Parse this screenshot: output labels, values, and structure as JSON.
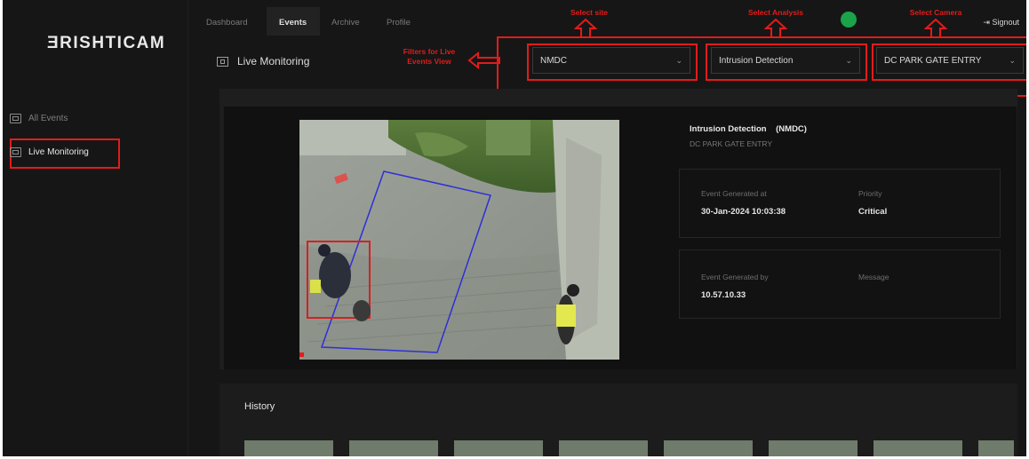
{
  "app": {
    "logo": "ƎRISHTICAM"
  },
  "nav": {
    "tabs": [
      {
        "label": "Dashboard",
        "active": false
      },
      {
        "label": "Events",
        "active": true
      },
      {
        "label": "Archive",
        "active": false
      },
      {
        "label": "Profile",
        "active": false
      }
    ],
    "signout": "Signout",
    "status_color": "#1aa34a"
  },
  "sidebar": {
    "items": [
      {
        "label": "All Events",
        "icon": "image-icon"
      },
      {
        "label": "Live Monitoring",
        "icon": "monitor-icon",
        "active": true
      }
    ]
  },
  "page": {
    "title": "Live Monitoring"
  },
  "annotations": {
    "filters": "Filters for Live\nEvents View",
    "site": "Select site",
    "analysis": "Select Analysis",
    "camera": "Select Camera"
  },
  "filters": {
    "site": "NMDC",
    "analysis": "Intrusion Detection",
    "camera": "DC PARK GATE ENTRY"
  },
  "event": {
    "title": "Intrusion Detection",
    "site_tag": "(NMDC)",
    "camera": "DC PARK GATE ENTRY",
    "generated_at_label": "Event Generated at",
    "generated_at": "30-Jan-2024 10:03:38",
    "priority_label": "Priority",
    "priority": "Critical",
    "generated_by_label": "Event Generated by",
    "generated_by": "10.57.10.33",
    "message_label": "Message",
    "message": ""
  },
  "history": {
    "title": "History"
  },
  "colors": {
    "accent": "#e31b1b",
    "status": "#1aa34a",
    "background": "#161616"
  }
}
